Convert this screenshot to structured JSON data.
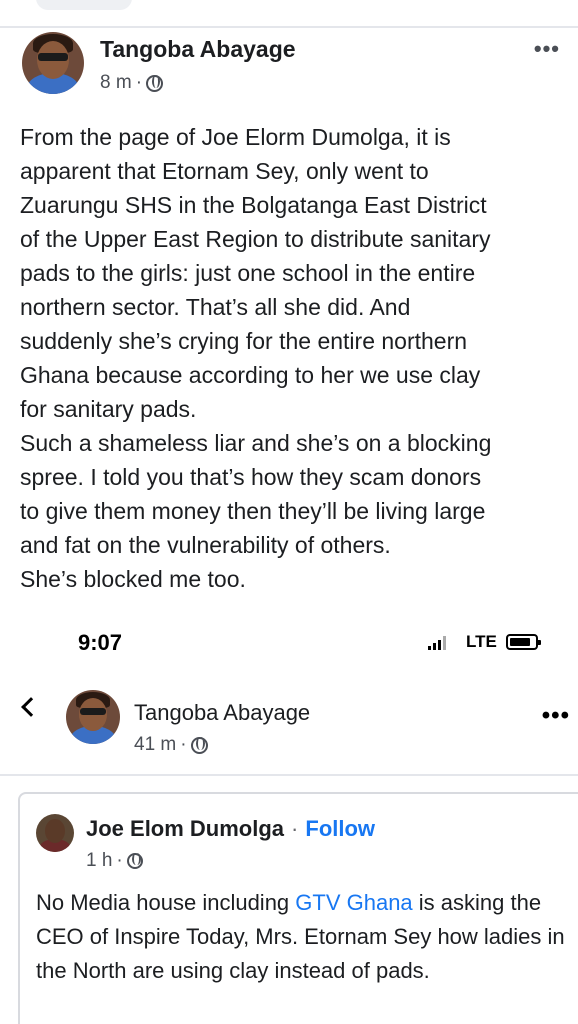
{
  "post1": {
    "author": "Tangoba Abayage",
    "time": "8 m",
    "separator": "·",
    "menu": "•••",
    "lines": [
      "From the page of Joe Elorm Dumolga, it is",
      "apparent that Etornam Sey, only went to",
      "Zuarungu SHS in the Bolgatanga East District",
      "of the Upper East Region to distribute sanitary",
      "pads to the girls: just one school in the entire",
      "northern sector. That’s all she did. And",
      "suddenly she’s crying for the entire northern",
      "Ghana because according to her we use clay",
      "for sanitary pads.",
      "Such a shameless liar and she’s on a blocking",
      "spree. I told you that’s how they scam donors",
      "to give them money then they’ll be living large",
      "and fat on the vulnerability of others.",
      "She’s blocked me too."
    ]
  },
  "status_bar": {
    "time": "9:07",
    "network": "LTE"
  },
  "post2": {
    "back": "back",
    "author": "Tangoba Abayage",
    "time": "41 m",
    "separator": "·",
    "menu": "•••"
  },
  "shared_post": {
    "author": "Joe Elom Dumolga",
    "dot": "·",
    "follow": "Follow",
    "time": "1 h",
    "separator": "·",
    "text_1": "No Media house including ",
    "link": "GTV Ghana",
    "text_2": " is asking the CEO of Inspire Today, Mrs. Etornam Sey how ladies in the North are using clay instead of pads."
  }
}
